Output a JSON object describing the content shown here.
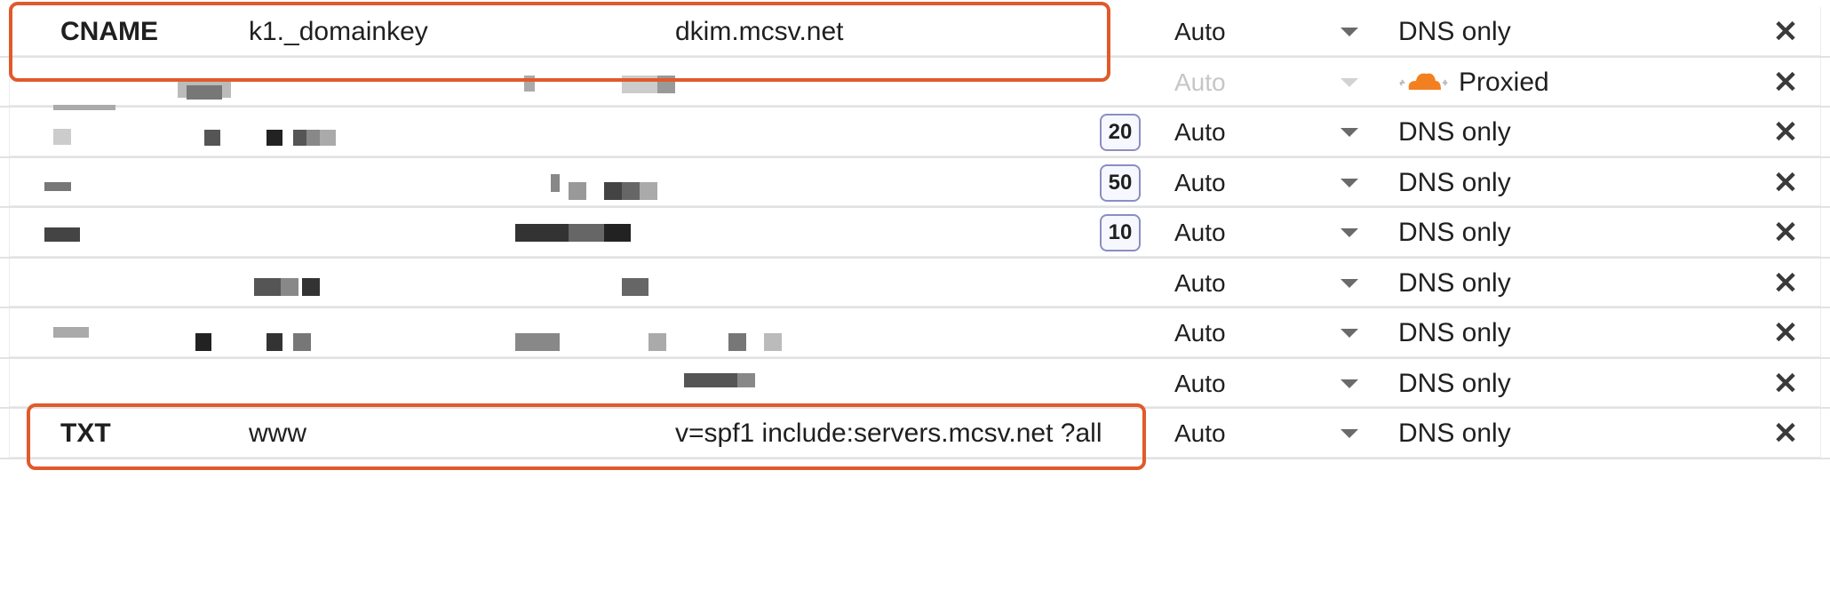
{
  "records": [
    {
      "type": "CNAME",
      "name": "k1._domainkey",
      "content": "dkim.mcsv.net",
      "priority": "",
      "ttl": "Auto",
      "proxy": "DNS only",
      "highlighted": true
    },
    {
      "type": "",
      "name": "",
      "content": "",
      "priority": "",
      "ttl": "Auto",
      "proxy": "Proxied",
      "highlighted": false,
      "ttl_disabled": true
    },
    {
      "type": "",
      "name": "",
      "content": "",
      "priority": "20",
      "ttl": "Auto",
      "proxy": "DNS only",
      "highlighted": false
    },
    {
      "type": "",
      "name": "",
      "content": "",
      "priority": "50",
      "ttl": "Auto",
      "proxy": "DNS only",
      "highlighted": false
    },
    {
      "type": "",
      "name": "",
      "content": "",
      "priority": "10",
      "ttl": "Auto",
      "proxy": "DNS only",
      "highlighted": false
    },
    {
      "type": "",
      "name": "",
      "content": "",
      "priority": "",
      "ttl": "Auto",
      "proxy": "DNS only",
      "highlighted": false
    },
    {
      "type": "",
      "name": "",
      "content": "",
      "priority": "",
      "ttl": "Auto",
      "proxy": "DNS only",
      "highlighted": false
    },
    {
      "type": "",
      "name": "",
      "content": "",
      "priority": "",
      "ttl": "Auto",
      "proxy": "DNS only",
      "highlighted": false
    },
    {
      "type": "TXT",
      "name": "www",
      "content": "v=spf1 include:servers.mcsv.net ?all",
      "priority": "",
      "ttl": "Auto",
      "proxy": "DNS only",
      "highlighted": true
    }
  ],
  "icons": {
    "delete": "close-icon",
    "proxied": "cloud-icon",
    "ttl_dropdown": "caret-down-icon"
  },
  "colors": {
    "highlight": "#e05a2b",
    "cloud": "#f38020",
    "priority_border": "#8a8ec0"
  }
}
